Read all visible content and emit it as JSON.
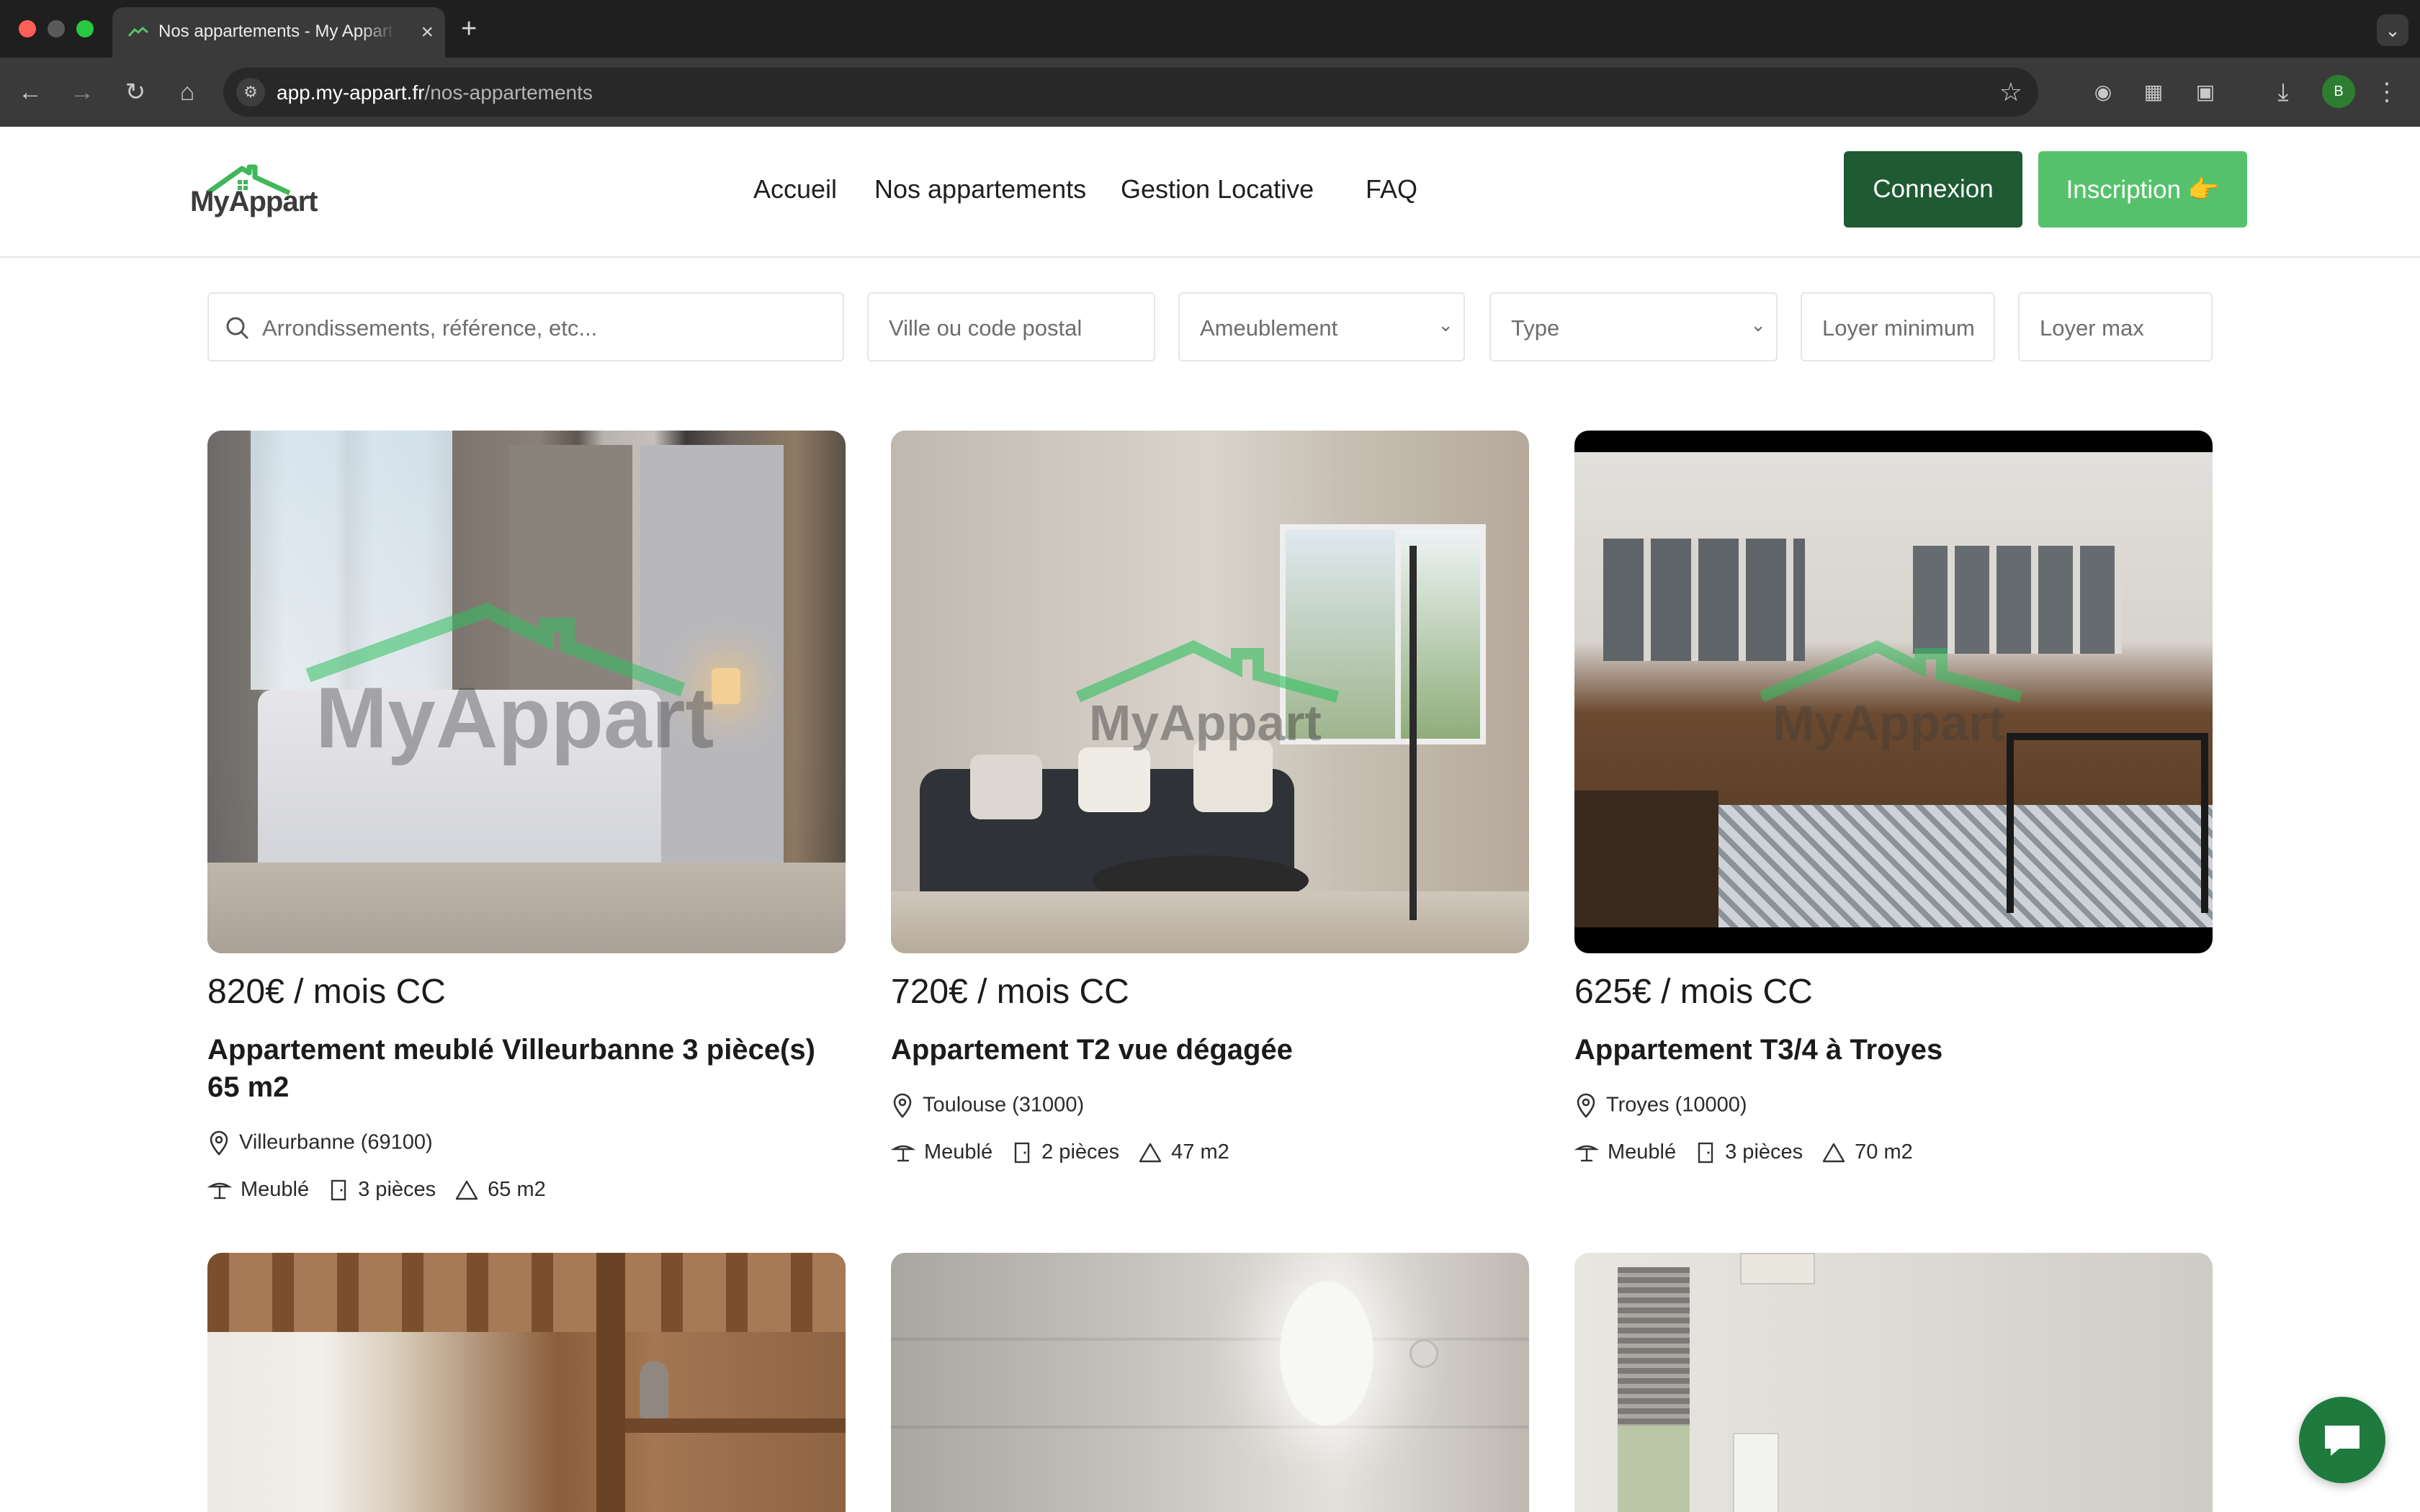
{
  "browser": {
    "tab_title": "Nos appartements - My Appart",
    "url_domain": "app.my-appart.fr",
    "url_path": "/nos-appartements",
    "profile_initial": "B"
  },
  "header": {
    "logo_text": "MyAppart",
    "nav": [
      "Accueil",
      "Nos appartements",
      "Gestion Locative",
      "FAQ"
    ],
    "login_label": "Connexion",
    "signup_label": "Inscription 👉"
  },
  "filters": {
    "search_placeholder": "Arrondissements, référence, etc...",
    "city_placeholder": "Ville ou code postal",
    "furnishing": "Ameublement",
    "type": "Type",
    "rent_min_placeholder": "Loyer minimum",
    "rent_max_placeholder": "Loyer max"
  },
  "listings": [
    {
      "price": "820€ / mois CC",
      "title": "Appartement meublé Villeurbanne 3 pièce(s) 65 m2",
      "location": "Villeurbanne (69100)",
      "furnished": "Meublé",
      "rooms": "3 pièces",
      "area": "65 m2"
    },
    {
      "price": "720€ / mois CC",
      "title": "Appartement T2 vue dégagée",
      "location": "Toulouse (31000)",
      "furnished": "Meublé",
      "rooms": "2 pièces",
      "area": "47 m2"
    },
    {
      "price": "625€ / mois CC",
      "title": "Appartement T3/4 à Troyes",
      "location": "Troyes (10000)",
      "furnished": "Meublé",
      "rooms": "3 pièces",
      "area": "70 m2"
    }
  ],
  "colors": {
    "brand_dark_green": "#1e5a32",
    "brand_light_green": "#55c26b",
    "chat_green": "#1f7a3e"
  }
}
